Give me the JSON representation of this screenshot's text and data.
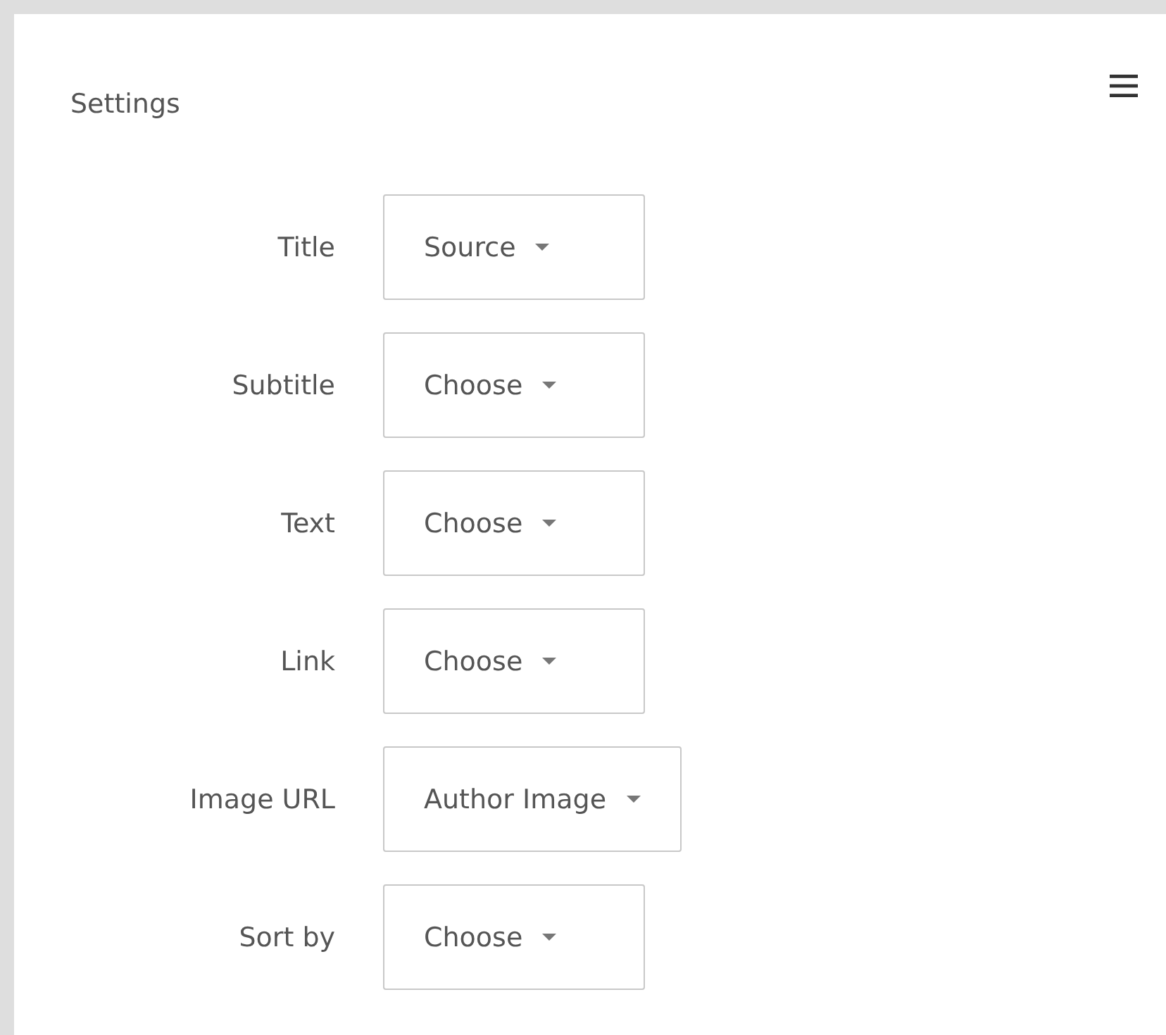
{
  "settings": {
    "title": "Settings",
    "fields": [
      {
        "label": "Title",
        "value": "Source"
      },
      {
        "label": "Subtitle",
        "value": "Choose"
      },
      {
        "label": "Text",
        "value": "Choose"
      },
      {
        "label": "Link",
        "value": "Choose"
      },
      {
        "label": "Image URL",
        "value": "Author Image"
      },
      {
        "label": "Sort by",
        "value": "Choose"
      }
    ]
  }
}
